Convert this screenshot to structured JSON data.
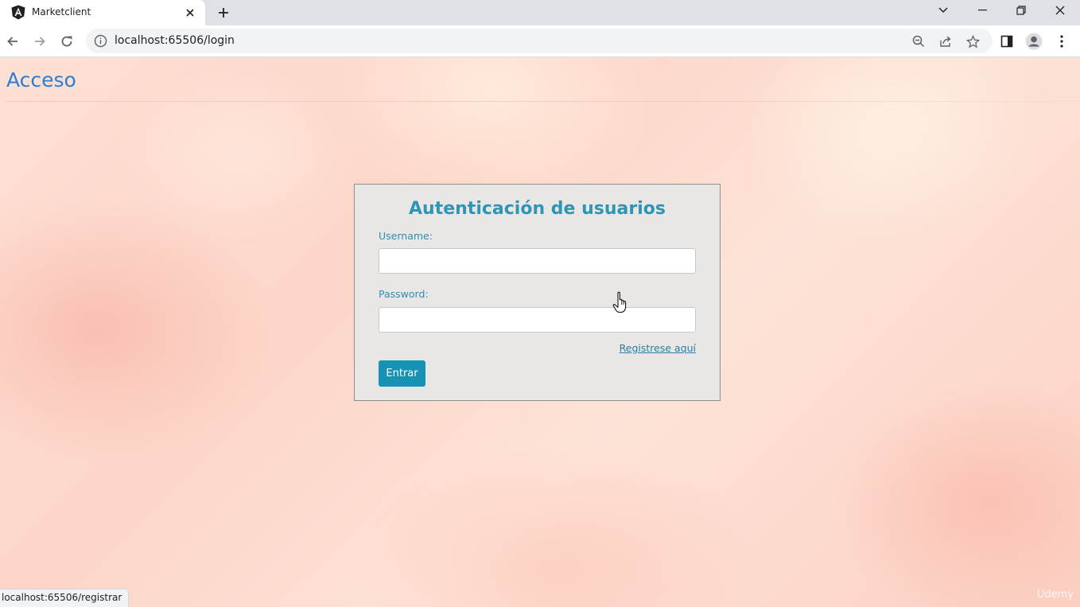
{
  "browser": {
    "tab": {
      "title": "Marketclient",
      "favicon": "angular-icon"
    },
    "address_bar": {
      "url": "localhost:65506/login"
    },
    "icons": [
      "back-icon",
      "forward-icon",
      "reload-icon",
      "info-icon",
      "zoom-icon",
      "share-icon",
      "bookmark-star-icon",
      "side-panel-icon",
      "profile-icon",
      "menu-icon",
      "tab-search-icon",
      "minimize-icon",
      "restore-icon",
      "close-icon",
      "new-tab-icon"
    ],
    "status_url": "localhost:65506/registrar"
  },
  "page": {
    "title": "Acceso",
    "login": {
      "heading": "Autenticación de usuarios",
      "username_label": "Username:",
      "username_value": "",
      "password_label": "Password:",
      "password_value": "",
      "register_link": "Registrese aquí",
      "submit_label": "Entrar"
    },
    "watermark": "Udemy"
  },
  "colors": {
    "title_blue": "#2a7fd4",
    "heading_teal": "#2e95b6",
    "button_teal": "#1592b4",
    "card_bg": "#e8e7e6"
  }
}
